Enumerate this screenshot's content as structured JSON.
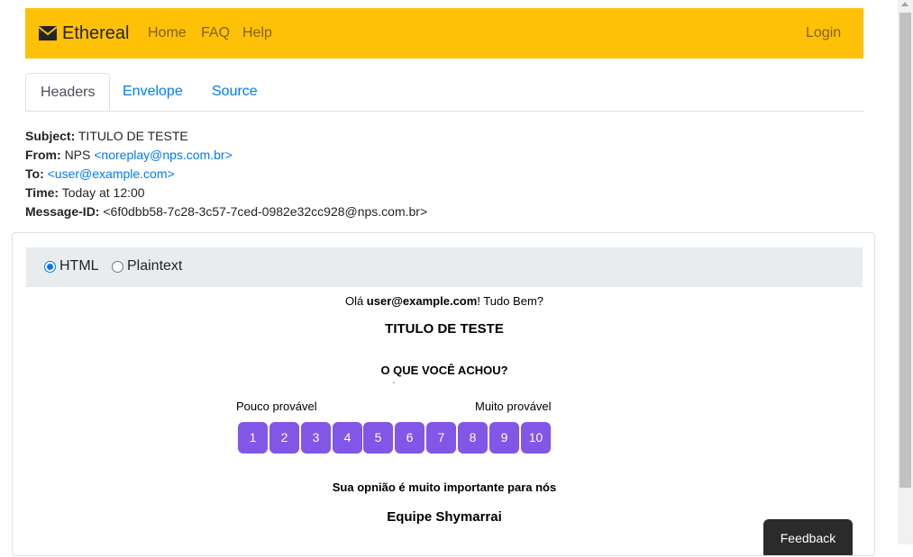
{
  "navbar": {
    "brand": "Ethereal",
    "brand_icon": "envelope-icon",
    "links": [
      "Home",
      "FAQ",
      "Help"
    ],
    "login": "Login",
    "color": "#ffc107"
  },
  "tabs": [
    {
      "label": "Headers",
      "active": true
    },
    {
      "label": "Envelope",
      "active": false
    },
    {
      "label": "Source",
      "active": false
    }
  ],
  "headers": {
    "subject_label": "Subject:",
    "subject": "TITULO DE TESTE",
    "from_label": "From:",
    "from_name": "NPS",
    "from_email": "<noreplay@nps.com.br>",
    "to_label": "To:",
    "to_email": "<user@example.com>",
    "time_label": "Time:",
    "time": "Today at 12:00",
    "message_id_label": "Message-ID:",
    "message_id": "<6f0dbb58-7c28-3c57-7ced-0982e32cc928@nps.com.br>"
  },
  "view_mode": {
    "options": [
      "HTML",
      "Plaintext"
    ],
    "selected": "HTML"
  },
  "email": {
    "greeting_pre": "Olá ",
    "greeting_user": "user@example.com",
    "greeting_post": "! Tudo Bem?",
    "title": "TITULO DE TESTE",
    "question": "O QUE VOCÊ ACHOU?",
    "low_label": "Pouco provável",
    "high_label": "Muito provável",
    "scale": [
      "1",
      "2",
      "3",
      "4",
      "5",
      "6",
      "7",
      "8",
      "9",
      "10"
    ],
    "scale_color": "#8256e6",
    "importance": "Sua opnião é muito importante para nós",
    "team": "Equipe Shymarrai"
  },
  "feedback_button": "Feedback"
}
